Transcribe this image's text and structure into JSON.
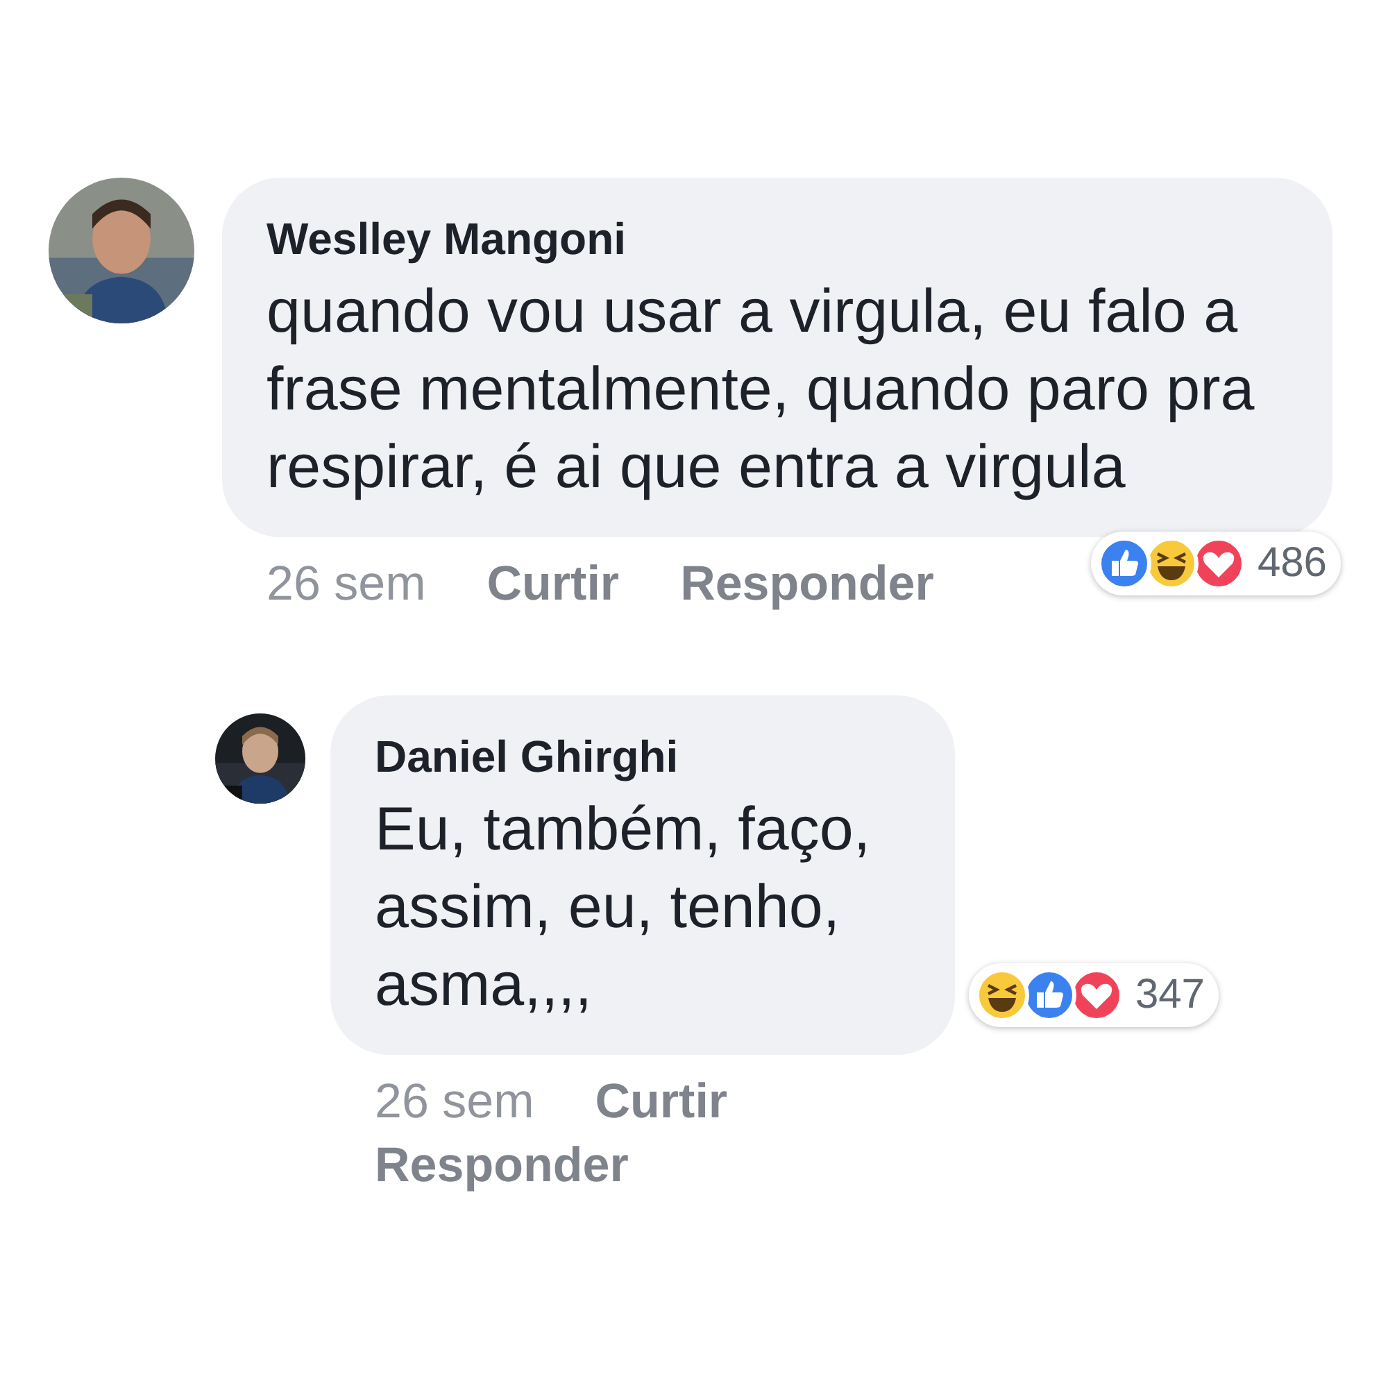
{
  "comments": [
    {
      "author": "Weslley Mangoni",
      "text": "quando vou usar a virgula, eu falo a frase mentalmente, quando paro pra respirar, é ai que entra a virgula",
      "time": "26 sem",
      "actions": [
        "Curtir",
        "Responder"
      ],
      "reactions": [
        {
          "kind": "like"
        },
        {
          "kind": "haha"
        },
        {
          "kind": "love"
        }
      ],
      "reaction_count": "486",
      "reply": false
    },
    {
      "author": "Daniel Ghirghi",
      "text": "Eu, também, faço, assim, eu, tenho, asma,,,,",
      "time": "26 sem",
      "actions": [
        "Curtir",
        "Responder"
      ],
      "reactions": [
        {
          "kind": "haha"
        },
        {
          "kind": "like"
        },
        {
          "kind": "love"
        }
      ],
      "reaction_count": "347",
      "reply": true
    }
  ]
}
